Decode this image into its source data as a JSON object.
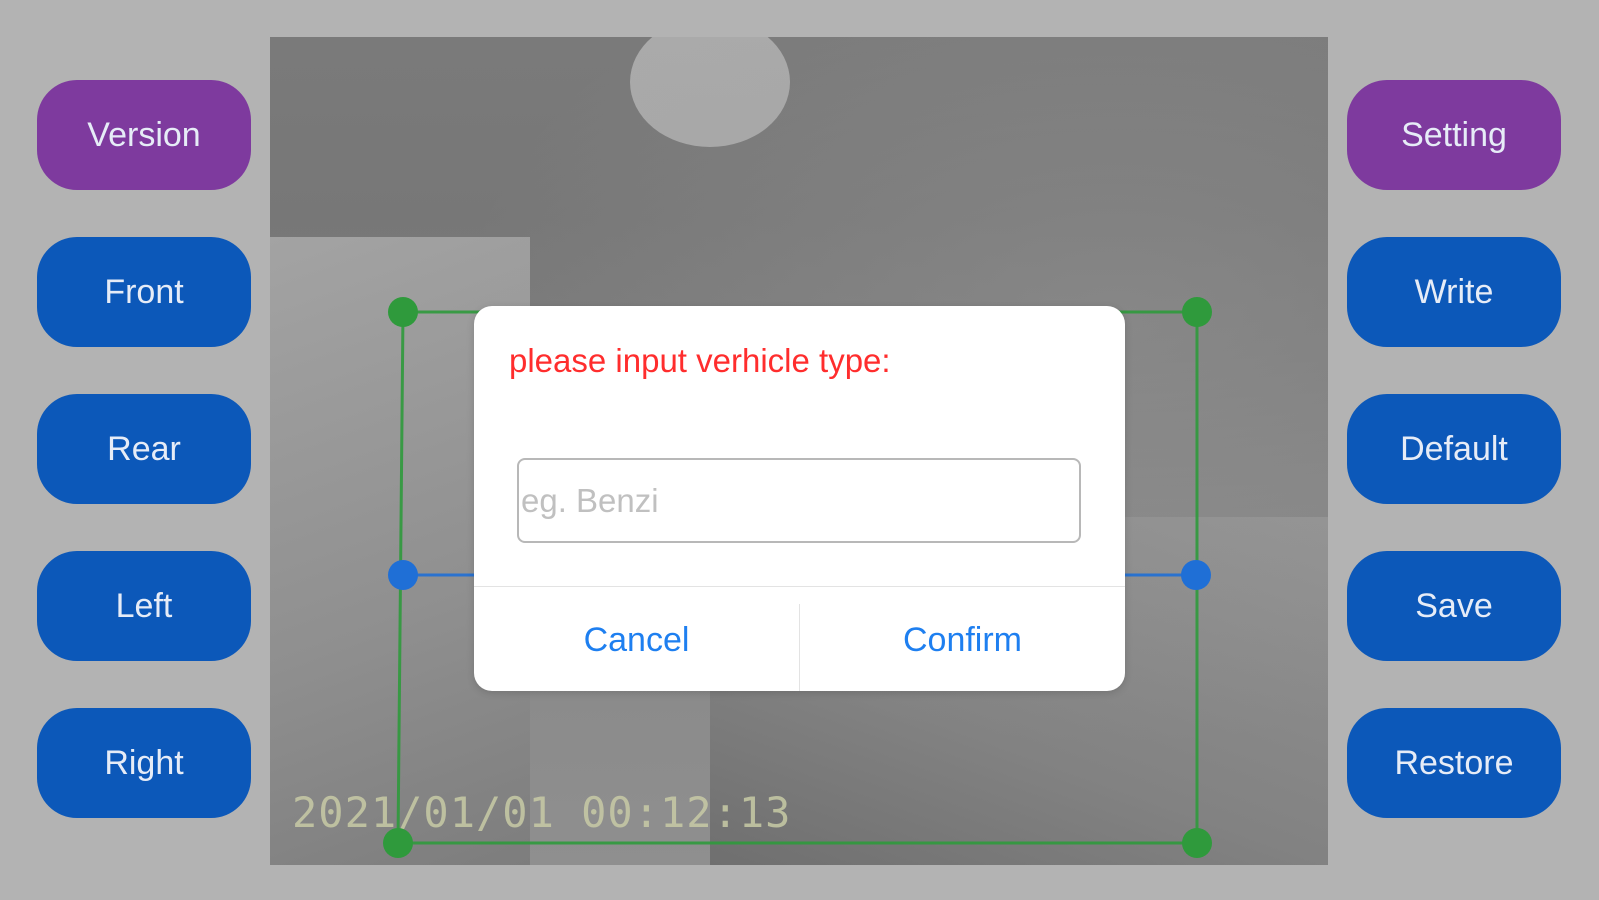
{
  "left_panel": {
    "buttons": [
      {
        "label": "Version",
        "color": "#7e3a9e"
      },
      {
        "label": "Front",
        "color": "#0c58b9"
      },
      {
        "label": "Rear",
        "color": "#0c58b9"
      },
      {
        "label": "Left",
        "color": "#0c58b9"
      },
      {
        "label": "Right",
        "color": "#0c58b9"
      }
    ]
  },
  "right_panel": {
    "buttons": [
      {
        "label": "Setting",
        "color": "#7e3a9e"
      },
      {
        "label": "Write",
        "color": "#0c58b9"
      },
      {
        "label": "Default",
        "color": "#0c58b9"
      },
      {
        "label": "Save",
        "color": "#0c58b9"
      },
      {
        "label": "Restore",
        "color": "#0c58b9"
      }
    ]
  },
  "camera": {
    "timestamp": "2021/01/01  00:12:13",
    "calibration_frame_color": "#2f9a3c",
    "midline_color": "#1f6fd6"
  },
  "dialog": {
    "title": "please input verhicle type:",
    "title_color": "#ff2d2d",
    "input_value": "",
    "input_placeholder": "eg. Benzi",
    "cancel_label": "Cancel",
    "confirm_label": "Confirm",
    "action_color": "#1e7ff0"
  }
}
